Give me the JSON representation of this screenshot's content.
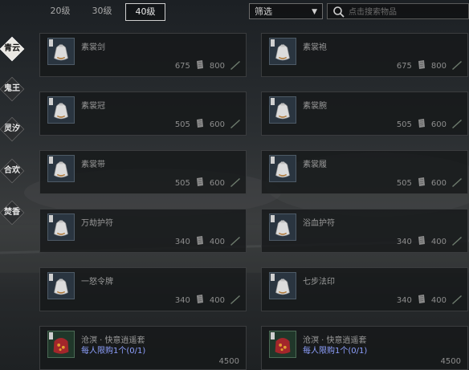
{
  "tabs": [
    {
      "label": "20级",
      "active": false
    },
    {
      "label": "30级",
      "active": false
    },
    {
      "label": "40级",
      "active": true
    }
  ],
  "filter": {
    "label": "筛选"
  },
  "search": {
    "placeholder": "点击搜索物品"
  },
  "sidebar": [
    {
      "label": "青云",
      "active": true
    },
    {
      "label": "鬼王",
      "active": false
    },
    {
      "label": "灵汐",
      "active": false
    },
    {
      "label": "合欢",
      "active": false
    },
    {
      "label": "焚香",
      "active": false
    }
  ],
  "items": [
    {
      "name": "素裳剑",
      "price": "675",
      "cost": "800"
    },
    {
      "name": "素裳袍",
      "price": "675",
      "cost": "800"
    },
    {
      "name": "素裳冠",
      "price": "505",
      "cost": "600"
    },
    {
      "name": "素裳腕",
      "price": "505",
      "cost": "600"
    },
    {
      "name": "素裳带",
      "price": "505",
      "cost": "600"
    },
    {
      "name": "素裳履",
      "price": "505",
      "cost": "600"
    },
    {
      "name": "万劫护符",
      "price": "340",
      "cost": "400"
    },
    {
      "name": "浴血护符",
      "price": "340",
      "cost": "400"
    },
    {
      "name": "一怒令牌",
      "price": "340",
      "cost": "400"
    },
    {
      "name": "七步法印",
      "price": "340",
      "cost": "400"
    },
    {
      "name": "沧溟 · 快意逍遥套",
      "limit": "每人限购1个(0/1)",
      "price": "4500",
      "green": true
    },
    {
      "name": "沧溟 · 快意逍遥套",
      "limit": "每人限购1个(0/1)",
      "price": "4500",
      "green": true
    }
  ],
  "colors": {
    "limit": "#8ea0ff",
    "active_tab_border": "#cfcfcf",
    "card_bg": "#16181a"
  }
}
